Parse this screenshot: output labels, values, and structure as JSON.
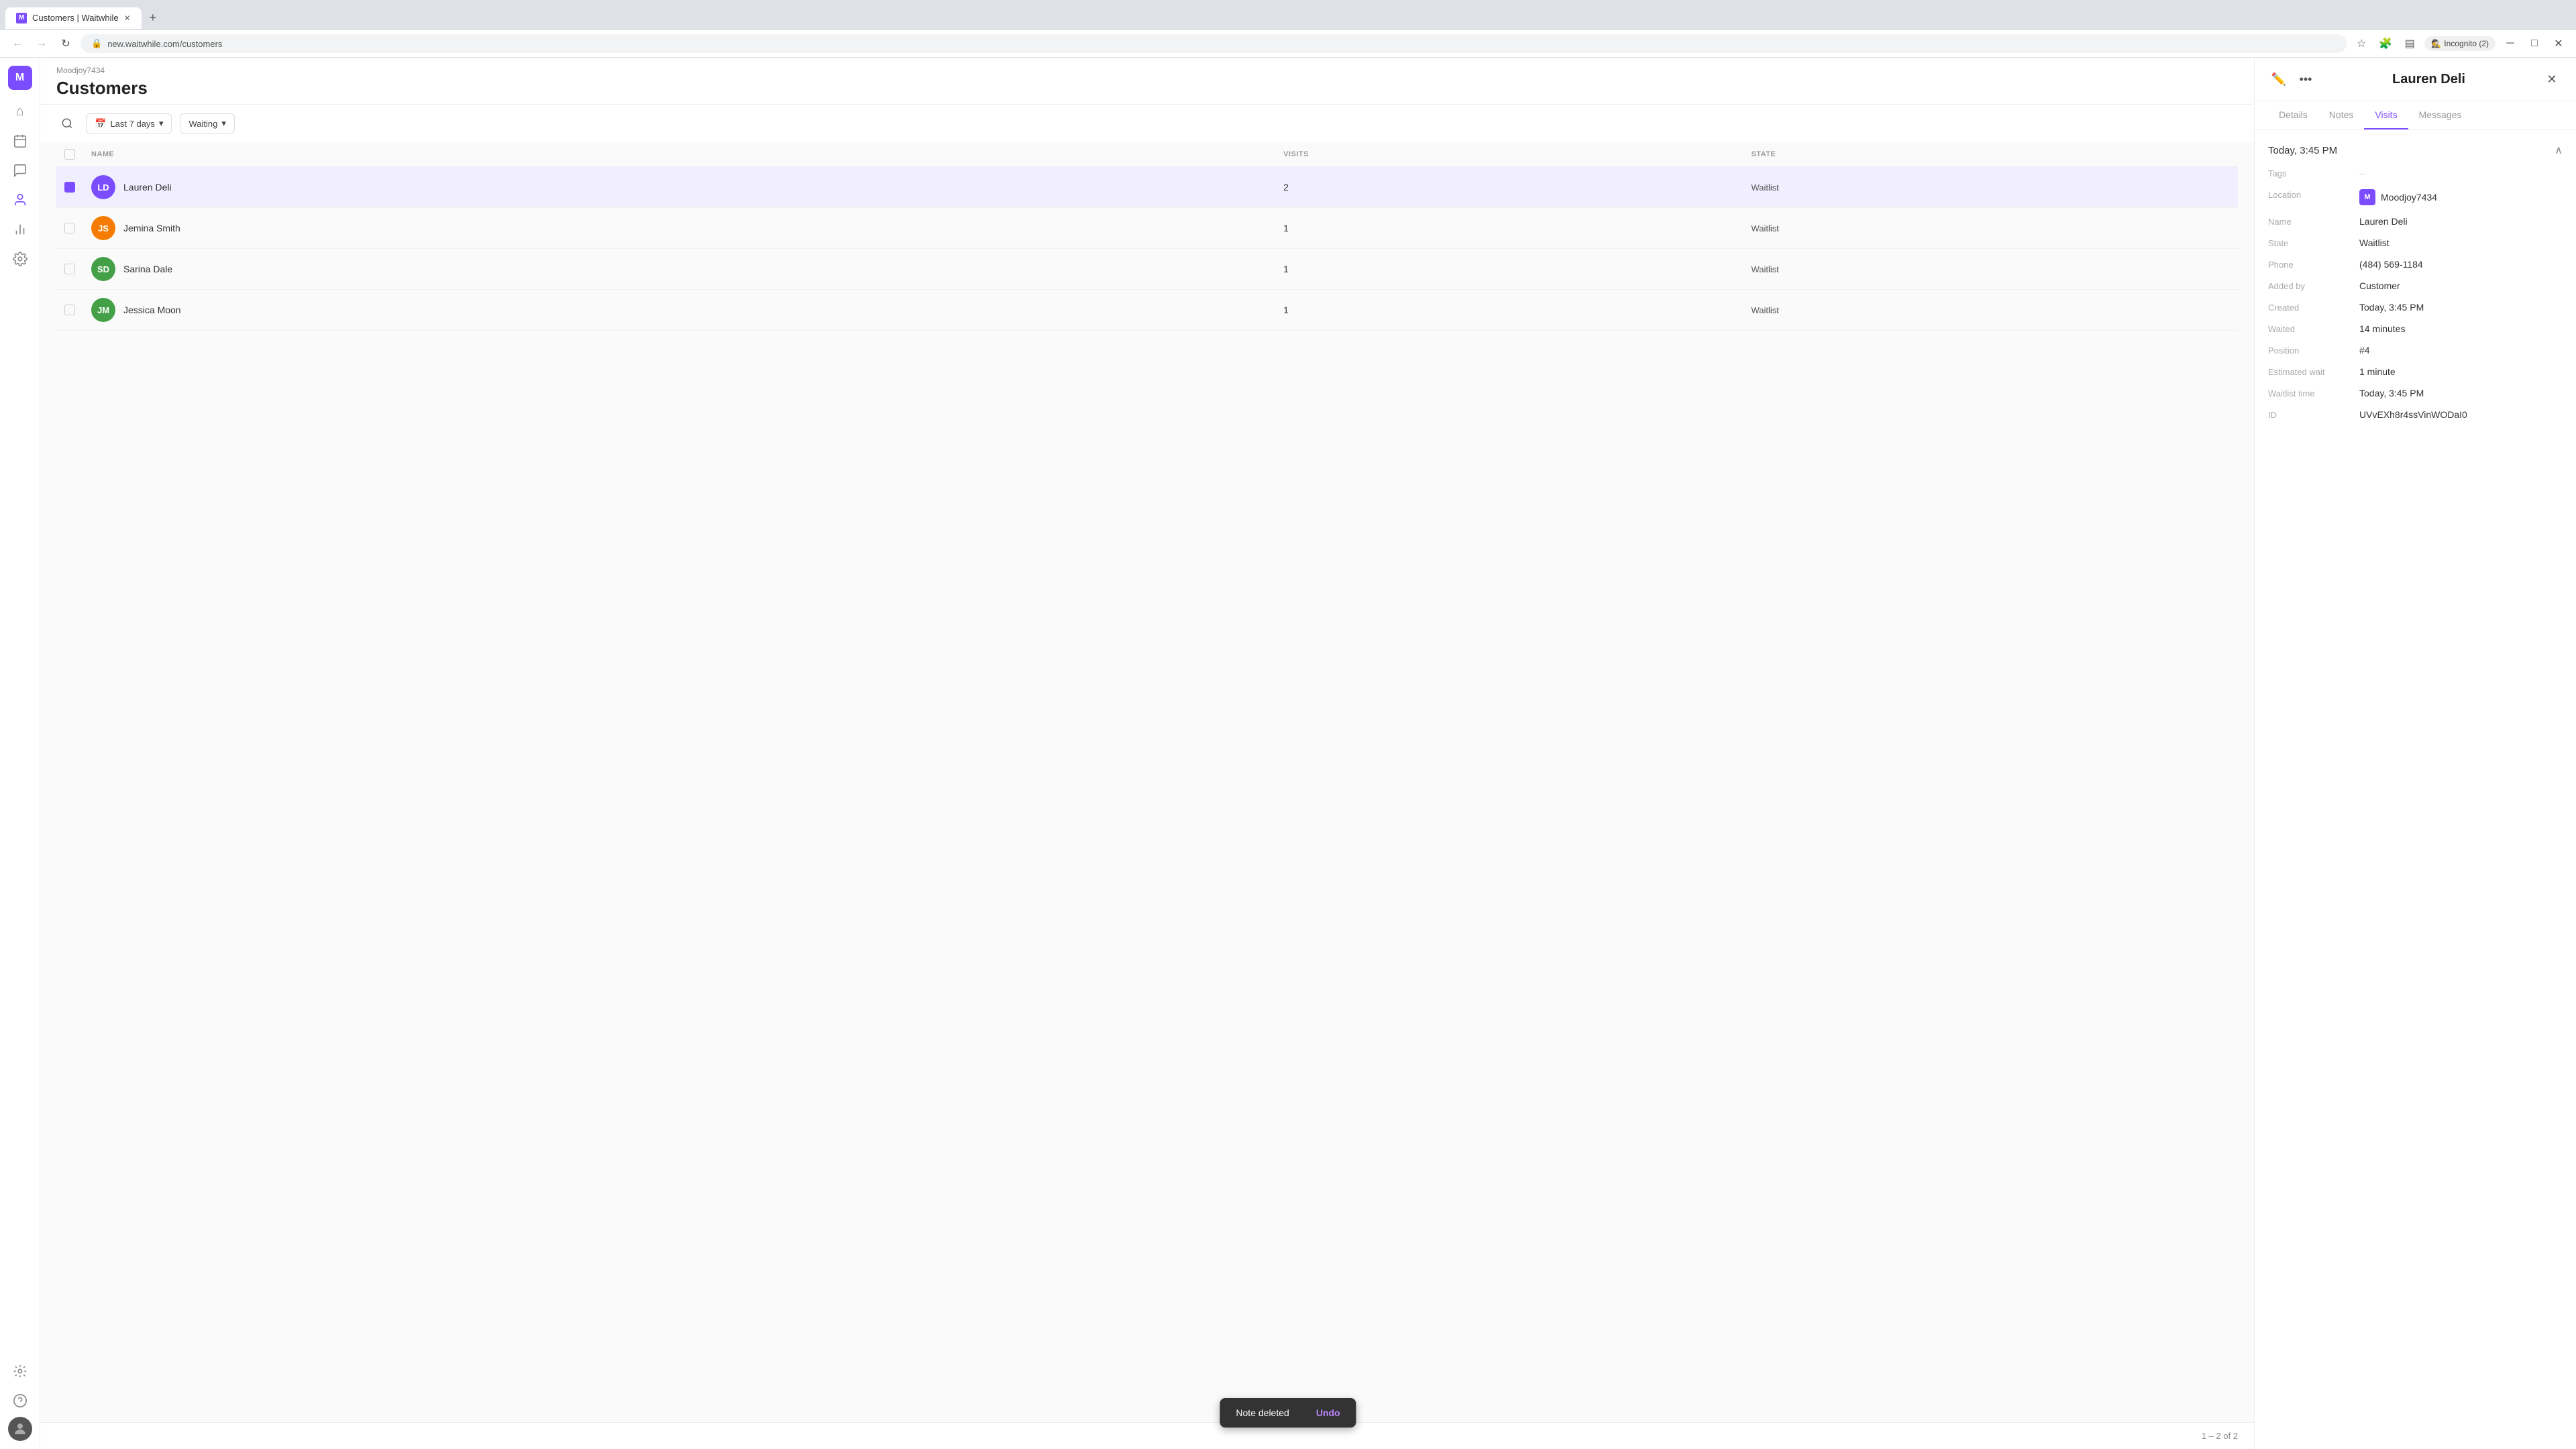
{
  "browser": {
    "tab_title": "Customers | Waitwhile",
    "tab_favicon": "M",
    "url": "new.waitwhile.com/customers",
    "incognito_label": "Incognito (2)"
  },
  "sidebar": {
    "logo_text": "M",
    "items": [
      {
        "id": "home",
        "icon": "⌂",
        "label": "Home"
      },
      {
        "id": "calendar",
        "icon": "▦",
        "label": "Calendar"
      },
      {
        "id": "chat",
        "icon": "💬",
        "label": "Messages"
      },
      {
        "id": "customers",
        "icon": "👤",
        "label": "Customers",
        "active": true
      },
      {
        "id": "analytics",
        "icon": "📊",
        "label": "Analytics"
      },
      {
        "id": "settings",
        "icon": "⚙",
        "label": "Settings"
      }
    ],
    "bottom_items": [
      {
        "id": "flash",
        "icon": "⚡",
        "label": "Integrations"
      },
      {
        "id": "help",
        "icon": "?",
        "label": "Help"
      }
    ]
  },
  "main": {
    "breadcrumb": "Moodjoy7434",
    "page_title": "Customers",
    "toolbar": {
      "search_placeholder": "Search",
      "date_filter_label": "Last 7 days",
      "state_filter_label": "Waiting"
    },
    "table": {
      "columns": [
        "NAME",
        "VISITS",
        "STATE"
      ],
      "rows": [
        {
          "id": 1,
          "name": "Lauren Deli",
          "initials": "LD",
          "avatar_color": "#7c4dff",
          "visits": 2,
          "state": "Waitlist",
          "selected": true
        },
        {
          "id": 2,
          "name": "Jemina Smith",
          "initials": "JS",
          "avatar_color": "#f57c00",
          "visits": 1,
          "state": "Waitlist"
        },
        {
          "id": 3,
          "name": "Sarina Dale",
          "initials": "SD",
          "avatar_color": "#43a047",
          "visits": 1,
          "state": "Waitlist"
        },
        {
          "id": 4,
          "name": "Jessica Moon",
          "initials": "JM",
          "avatar_color": "#43a047",
          "visits": 1,
          "state": "Waitlist"
        }
      ]
    },
    "pagination": "1 – 2 of 2"
  },
  "panel": {
    "title": "Lauren Deli",
    "tabs": [
      {
        "id": "details",
        "label": "Details"
      },
      {
        "id": "notes",
        "label": "Notes"
      },
      {
        "id": "visits",
        "label": "Visits",
        "active": true
      },
      {
        "id": "messages",
        "label": "Messages"
      }
    ],
    "visit": {
      "date": "Today, 3:45 PM",
      "details": [
        {
          "label": "Tags",
          "value": "–",
          "type": "dash"
        },
        {
          "label": "Location",
          "value": "Moodjoy7434",
          "type": "location"
        },
        {
          "label": "Name",
          "value": "Lauren Deli"
        },
        {
          "label": "State",
          "value": "Waitlist"
        },
        {
          "label": "Phone",
          "value": "(484) 569-1184"
        },
        {
          "label": "Added by",
          "value": "Customer"
        },
        {
          "label": "Created",
          "value": "Today, 3:45 PM"
        },
        {
          "label": "Waited",
          "value": "14 minutes"
        },
        {
          "label": "Position",
          "value": "#4"
        },
        {
          "label": "Estimated wait",
          "value": "1 minute"
        },
        {
          "label": "Waitlist time",
          "value": "Today, 3:45 PM"
        },
        {
          "label": "ID",
          "value": "UVvEXh8r4ssVinWODaI0"
        }
      ]
    }
  },
  "snackbar": {
    "message": "Note deleted",
    "undo_label": "Undo"
  }
}
